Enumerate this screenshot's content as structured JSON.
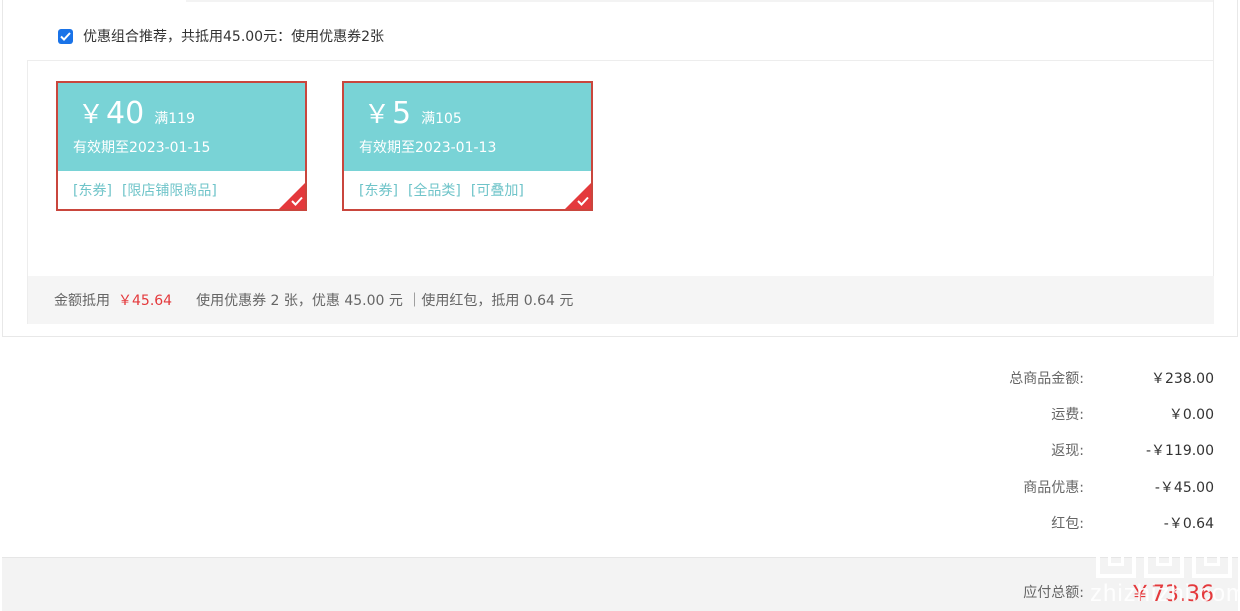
{
  "recommend": {
    "checked": true,
    "text": "优惠组合推荐，共抵用45.00元：使用优惠券2张"
  },
  "coupons": [
    {
      "currency": "￥",
      "amount": "40",
      "condition": "满119",
      "expire": "有效期至2023-01-15",
      "tags": [
        "[东券]",
        "[限店铺限商品]"
      ],
      "selected": true
    },
    {
      "currency": "￥",
      "amount": "5",
      "condition": "满105",
      "expire": "有效期至2023-01-13",
      "tags": [
        "[东券]",
        "[全品类]",
        "[可叠加]"
      ],
      "selected": true
    }
  ],
  "summary": {
    "label": "金额抵用",
    "amount": "￥45.64",
    "detail": "使用优惠券 2 张，优惠 45.00 元 ｜使用红包，抵用 0.64 元"
  },
  "totals": [
    {
      "label": "总商品金额:",
      "value": "￥238.00"
    },
    {
      "label": "运费:",
      "value": "￥0.00"
    },
    {
      "label": "返现:",
      "value": "-￥119.00"
    },
    {
      "label": "商品优惠:",
      "value": "-￥45.00"
    },
    {
      "label": "红包:",
      "value": "-￥0.64"
    }
  ],
  "payable": {
    "label": "应付总额:",
    "value": "￥73.36"
  },
  "watermark": {
    "text": "zhizhizhi.com"
  },
  "colors": {
    "coupon_bg": "#79d3d6",
    "coupon_border": "#c9463d",
    "accent_red": "#e4393c",
    "tag_teal": "#6fc4c9"
  }
}
